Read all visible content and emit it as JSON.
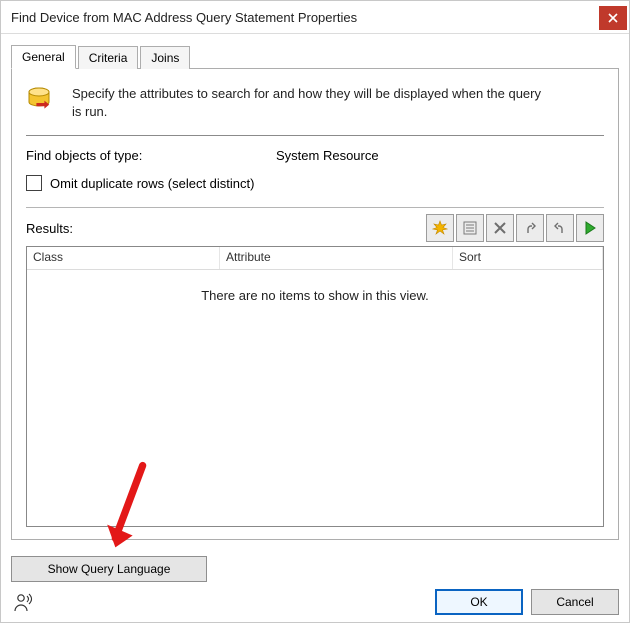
{
  "window": {
    "title": "Find Device from MAC Address Query Statement Properties"
  },
  "tabs": {
    "general": "General",
    "criteria": "Criteria",
    "joins": "Joins"
  },
  "general": {
    "description": "Specify the attributes to search for and how they will be displayed when the query is run.",
    "object_type_label": "Find objects of type:",
    "object_type_value": "System Resource",
    "omit_label": "Omit duplicate rows (select distinct)",
    "results_label": "Results:",
    "columns": {
      "class": "Class",
      "attribute": "Attribute",
      "sort": "Sort"
    },
    "empty": "There are no items to show in this view."
  },
  "buttons": {
    "show_query": "Show Query Language",
    "ok": "OK",
    "cancel": "Cancel"
  }
}
